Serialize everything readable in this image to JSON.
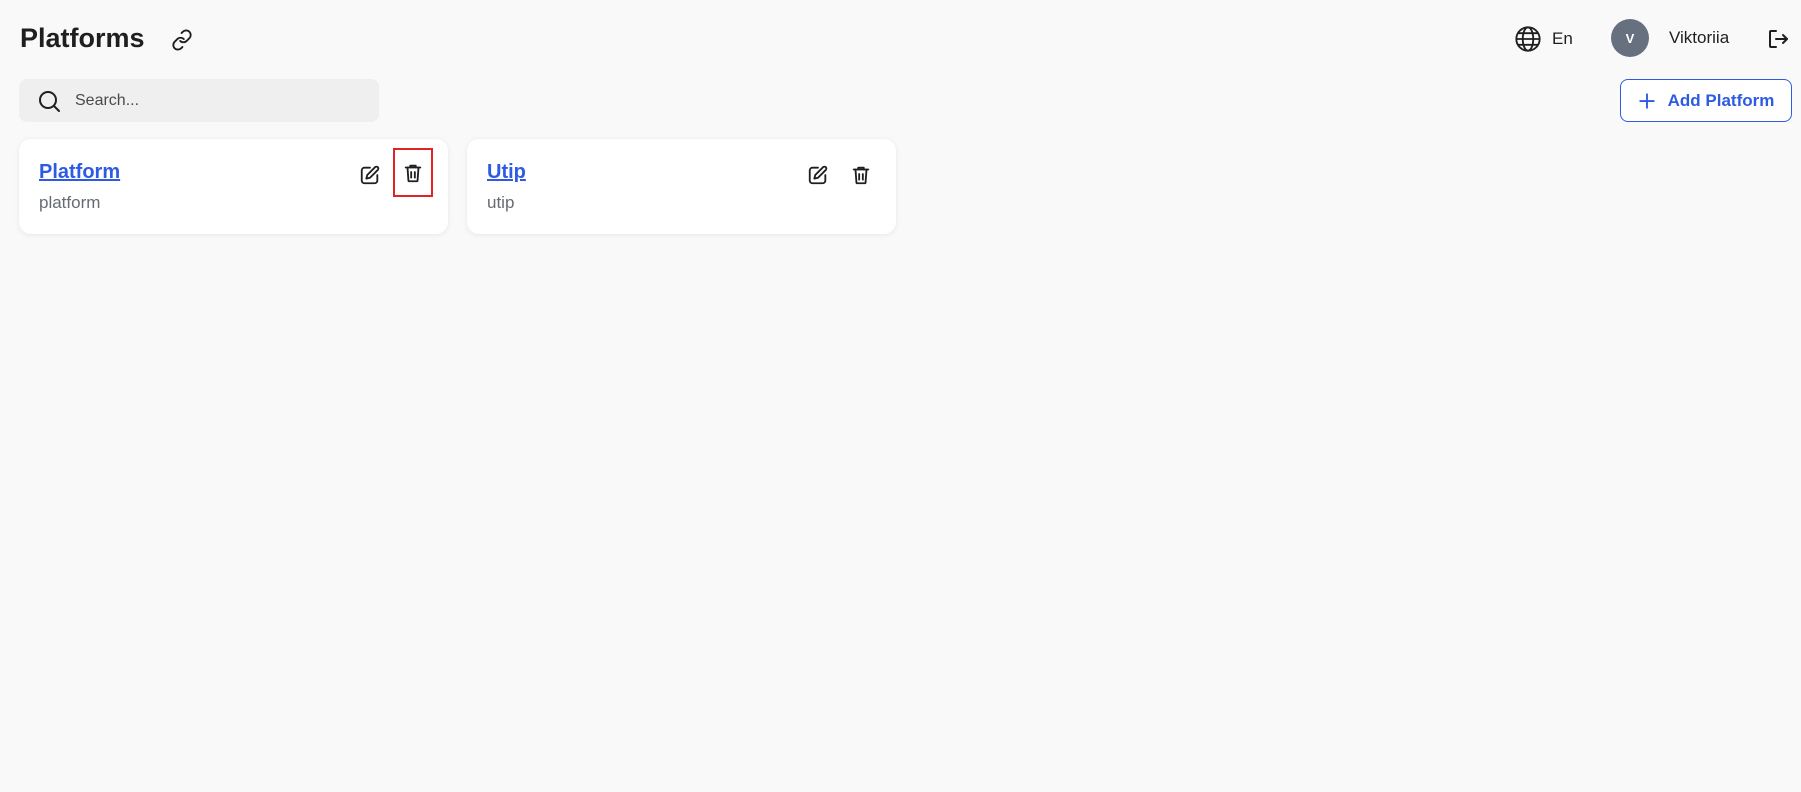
{
  "header": {
    "title": "Platforms",
    "language": "En",
    "user": {
      "initial": "V",
      "name": "Viktoriia"
    }
  },
  "search": {
    "placeholder": "Search...",
    "value": ""
  },
  "toolbar": {
    "add_label": "Add Platform"
  },
  "cards": [
    {
      "title": "Platform",
      "subtitle": "platform"
    },
    {
      "title": "Utip",
      "subtitle": "utip"
    }
  ],
  "icons": {
    "link": "link-icon",
    "globe": "globe-icon",
    "logout": "logout-icon",
    "search": "search-icon",
    "plus": "plus-icon",
    "edit": "edit-icon",
    "delete": "trash-icon"
  },
  "colors": {
    "accent": "#2d5be3",
    "avatar": "#66707f",
    "background": "#f9f9f9",
    "focus_outline": "#e02424"
  }
}
